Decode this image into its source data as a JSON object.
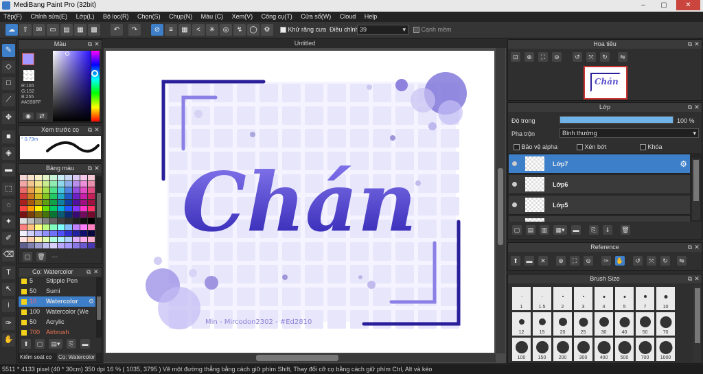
{
  "window": {
    "title": "MediBang Paint Pro (32bit)",
    "minimize": "–",
    "maximize": "▢",
    "close": "✕"
  },
  "menu": [
    "Tệp(F)",
    "Chỉnh sửa(E)",
    "Lớp(L)",
    "Bộ lọc(R)",
    "Chọn(S)",
    "Chụp(N)",
    "Màu (C)",
    "Xem(V)",
    "Công cụ(T)",
    "Cửa sổ(W)",
    "Cloud",
    "Help"
  ],
  "toolbar": {
    "antialias_label": "Khử răng cưa",
    "adjust_label": "Điều chỉnh",
    "adjust_value": "39",
    "snap_label": "Cạnh mềm"
  },
  "color_panel": {
    "title": "Màu",
    "r": "R:165",
    "g": "G:152",
    "b": "B:255",
    "hex": "#A598FF",
    "fg": "#A598FF"
  },
  "preview_panel": {
    "title": "Xem trước cọ",
    "size": "0.73m"
  },
  "palette_panel": {
    "title": "Bảng màu",
    "extra": "---"
  },
  "brush_panel": {
    "title": "Cọ: Watercolor",
    "brushes": [
      {
        "size": "5",
        "name": "Stipple Pen",
        "color": "#f2d21a"
      },
      {
        "size": "50",
        "name": "Sumi",
        "color": "#f2d21a"
      },
      {
        "size": "10",
        "name": "Watercolor",
        "color": "#f2d21a"
      },
      {
        "size": "100",
        "name": "Watercolor (We",
        "color": "#f2d21a"
      },
      {
        "size": "50",
        "name": "Acrylic",
        "color": "#f2d21a"
      },
      {
        "size": "700",
        "name": "Airbrush",
        "color": "#f2d21a"
      }
    ],
    "tabs": [
      "Kiểm soát cọ",
      "Cọ: Watercolor"
    ]
  },
  "document": {
    "tab": "Untitled",
    "lettering": "Chán",
    "signature": "Min - Mircodon2302 - #Ed2810"
  },
  "navigator": {
    "title": "Hoa tiêu"
  },
  "layers": {
    "title": "Lớp",
    "opacity_label": "Độ trong",
    "opacity_value": "100 %",
    "opacity_percent": 100,
    "blend_label": "Pha trộn",
    "blend_value": "Bình thường",
    "protect_alpha": "Bảo vệ alpha",
    "clipping": "Xén bớt",
    "lock": "Khóa",
    "items": [
      "Lớp7",
      "Lớp6",
      "Lớp5"
    ]
  },
  "reference": {
    "title": "Reference"
  },
  "brush_size": {
    "title": "Brush Size",
    "sizes": [
      "1",
      "1.5",
      "2",
      "3",
      "4",
      "5",
      "7",
      "10",
      "12",
      "15",
      "20",
      "25",
      "30",
      "40",
      "50",
      "70",
      "100",
      "150",
      "200",
      "300",
      "400",
      "500",
      "700",
      "1000"
    ]
  },
  "status": "5511 * 4133 pixel   (40 * 30cm)   350 dpi   16 %   ( 1035, 3795 )   Vẽ một đường thẳng bằng cách giữ phím Shift, Thay đổi cỡ cọ bằng cách giữ phím Ctrl, Alt và kéo",
  "colors": {
    "accent": "#3d7fc9",
    "lettering": "#5a4fd0",
    "frame": "#2a1f9a",
    "grid": "#eeecff"
  }
}
